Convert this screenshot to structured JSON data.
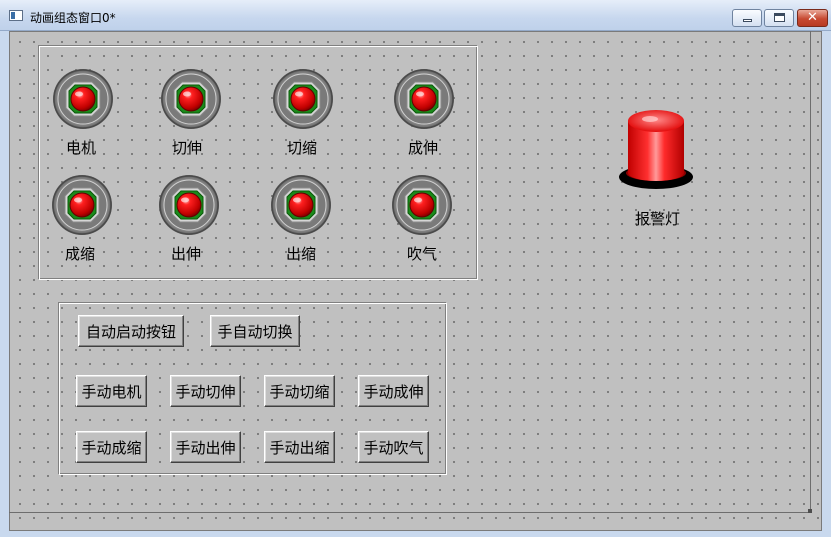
{
  "window": {
    "title": "动画组态窗口0*"
  },
  "lamps": [
    {
      "label": "电机"
    },
    {
      "label": "切伸"
    },
    {
      "label": "切缩"
    },
    {
      "label": "成伸"
    },
    {
      "label": "成缩"
    },
    {
      "label": "出伸"
    },
    {
      "label": "出缩"
    },
    {
      "label": "吹气"
    }
  ],
  "controls": {
    "auto_start": "自动启动按钮",
    "manual_switch": "手自动切换",
    "manual_buttons": [
      "手动电机",
      "手动切伸",
      "手动切缩",
      "手动成伸",
      "手动成缩",
      "手动出伸",
      "手动出缩",
      "手动吹气"
    ]
  },
  "alarm": {
    "label": "报警灯"
  },
  "colors": {
    "lamp_red": "#ff0000",
    "lamp_ring_green": "#1a8a1a",
    "panel_bg": "#c0c0c0"
  }
}
